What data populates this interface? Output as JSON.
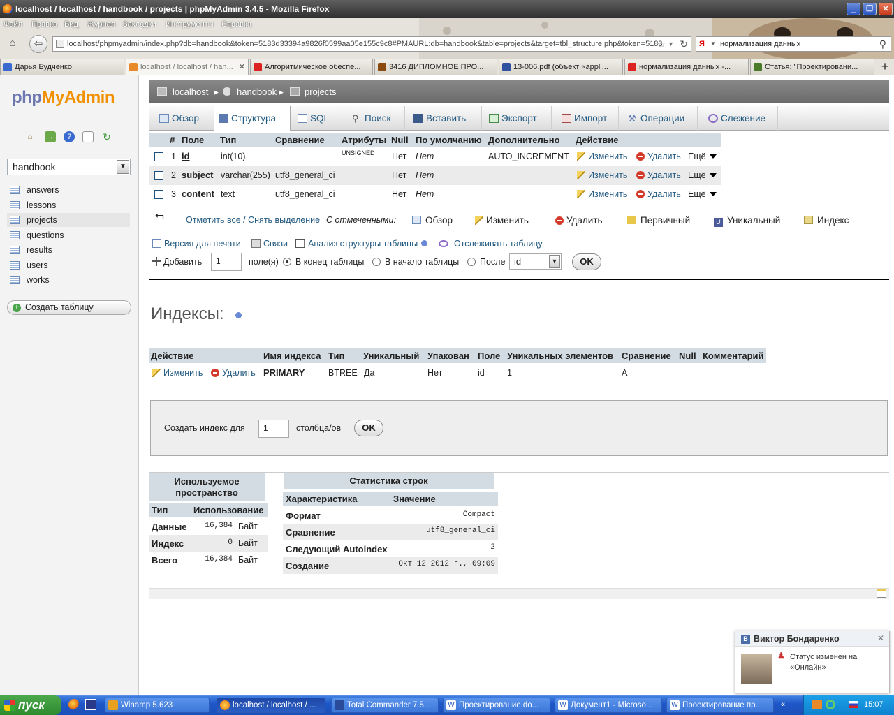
{
  "window": {
    "title": "localhost / localhost / handbook / projects | phpMyAdmin 3.4.5 - Mozilla Firefox"
  },
  "menu": [
    "Файл",
    "Правка",
    "Вид",
    "Журнал",
    "Закладки",
    "Инструменты",
    "Справка"
  ],
  "url": "localhost/phpmyadmin/index.php?db=handbook&token=5183d33394a9826f0599aa05e155c9c8#PMAURL:db=handbook&table=projects&target=tbl_structure.php&token=5183",
  "search_value": "нормализация данных",
  "tabs": [
    "Дарья Будченко",
    "localhost / localhost / han...",
    "Алгоритмическое обеспе...",
    "3416 ДИПЛОМНОЕ ПРО...",
    "13-006.pdf (объект «appli...",
    "нормализация данных -...",
    "Статья: \"Проектировани..."
  ],
  "sidebar": {
    "logo_php": "php",
    "logo_myadmin": "MyAdmin",
    "db_selected": "handbook",
    "tables": [
      "answers",
      "lessons",
      "projects",
      "questions",
      "results",
      "users",
      "works"
    ],
    "selected_table": "projects",
    "create_table": "Создать таблицу"
  },
  "breadcrumb": {
    "server": "localhost",
    "db": "handbook",
    "table": "projects"
  },
  "top_menu": [
    "Обзор",
    "Структура",
    "SQL",
    "Поиск",
    "Вставить",
    "Экспорт",
    "Импорт",
    "Операции",
    "Слежение"
  ],
  "structure": {
    "headers": [
      "#",
      "Поле",
      "Тип",
      "Сравнение",
      "Атрибуты",
      "Null",
      "По умолчанию",
      "Дополнительно",
      "Действие"
    ],
    "rows": [
      {
        "num": "1",
        "field": "id",
        "type": "int(10)",
        "collation": "",
        "attributes": "UNSIGNED",
        "null": "Нет",
        "default": "Нет",
        "extra": "AUTO_INCREMENT"
      },
      {
        "num": "2",
        "field": "subject",
        "type": "varchar(255)",
        "collation": "utf8_general_ci",
        "attributes": "",
        "null": "Нет",
        "default": "Нет",
        "extra": ""
      },
      {
        "num": "3",
        "field": "content",
        "type": "text",
        "collation": "utf8_general_ci",
        "attributes": "",
        "null": "Нет",
        "default": "Нет",
        "extra": ""
      }
    ],
    "action_edit": "Изменить",
    "action_delete": "Удалить",
    "action_more": "Ещё"
  },
  "with_selected": {
    "check_all": "Отметить все / Снять выделение",
    "label": "С отмеченными:",
    "actions": [
      "Обзор",
      "Изменить",
      "Удалить",
      "Первичный",
      "Уникальный",
      "Индекс"
    ]
  },
  "links": {
    "print": "Версия для печати",
    "relations": "Связи",
    "analyze": "Анализ структуры таблицы",
    "track": "Отслеживать таблицу"
  },
  "add_fields": {
    "label": "Добавить",
    "value": "1",
    "suffix": "поле(я)",
    "opt_end": "В конец таблицы",
    "opt_begin": "В начало таблицы",
    "opt_after": "После",
    "after_field": "id",
    "ok": "OK"
  },
  "indexes": {
    "title": "Индексы:",
    "headers": [
      "Действие",
      "Имя индекса",
      "Тип",
      "Уникальный",
      "Упакован",
      "Поле",
      "Уникальных элементов",
      "Сравнение",
      "Null",
      "Комментарий"
    ],
    "row": {
      "edit": "Изменить",
      "delete": "Удалить",
      "name": "PRIMARY",
      "type": "BTREE",
      "unique": "Да",
      "packed": "Нет",
      "field": "id",
      "cardinality": "1",
      "collation": "A",
      "null": "",
      "comment": ""
    },
    "create_label": "Создать индекс для",
    "create_value": "1",
    "create_suffix": "столбца/ов",
    "ok": "OK"
  },
  "space": {
    "title": "Используемое пространство",
    "headers": [
      "Тип",
      "Использование"
    ],
    "rows": [
      {
        "type": "Данные",
        "value": "16,384",
        "unit": "Байт"
      },
      {
        "type": "Индекс",
        "value": "0",
        "unit": "Байт"
      },
      {
        "type": "Всего",
        "value": "16,384",
        "unit": "Байт"
      }
    ]
  },
  "rowstats": {
    "title": "Статистика строк",
    "headers": [
      "Характеристика",
      "Значение"
    ],
    "rows": [
      {
        "k": "Формат",
        "v": "Compact"
      },
      {
        "k": "Сравнение",
        "v": "utf8_general_ci"
      },
      {
        "k": "Следующий Autoindex",
        "v": "2"
      },
      {
        "k": "Создание",
        "v": "Окт 12 2012 г., 09:09"
      }
    ]
  },
  "notification": {
    "name": "Виктор Бондаренко",
    "text": "Статус изменен на «Онлайн»"
  },
  "taskbar": {
    "start": "пуск",
    "items": [
      "Winamp 5.623",
      "localhost / localhost / ...",
      "Total Commander 7.5...",
      "Проектирование.do...",
      "Документ1 - Microso...",
      "Проектирование пр..."
    ],
    "clock": "15:07"
  }
}
